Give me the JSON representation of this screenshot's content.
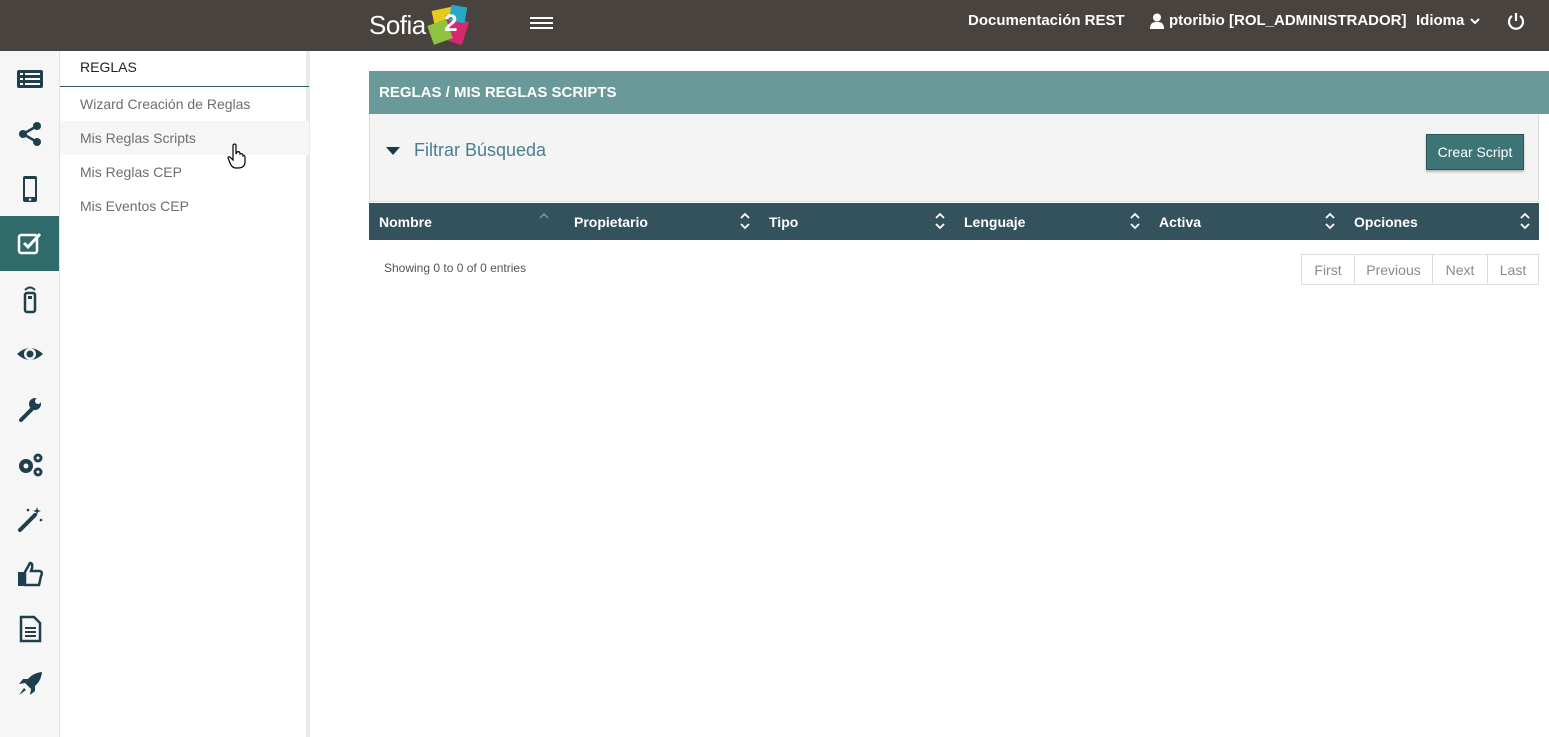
{
  "header": {
    "logo_text": "Sofia",
    "logo_mark": "2",
    "doc_link": "Documentación REST",
    "user": "ptoribio [ROL_ADMINISTRADOR]",
    "language": "Idioma"
  },
  "rail": {
    "icons": [
      "list-icon",
      "share-icon",
      "mobile-icon",
      "edit-check-icon",
      "remote-icon",
      "eye-icon",
      "wrench-icon",
      "gears-icon",
      "magic-wand-icon",
      "thumbs-up-icon",
      "document-icon",
      "rocket-icon"
    ],
    "active": "edit-check-icon"
  },
  "submenu": {
    "title": "REGLAS",
    "items": [
      {
        "label": "Wizard Creación de Reglas"
      },
      {
        "label": "Mis Reglas Scripts"
      },
      {
        "label": "Mis Reglas CEP"
      },
      {
        "label": "Mis Eventos CEP"
      }
    ]
  },
  "main": {
    "breadcrumb": "REGLAS / MIS REGLAS SCRIPTS",
    "filter_label": "Filtrar Búsqueda",
    "create_button": "Crear Script",
    "columns": [
      {
        "label": "Nombre"
      },
      {
        "label": "Propietario"
      },
      {
        "label": "Tipo"
      },
      {
        "label": "Lenguaje"
      },
      {
        "label": "Activa"
      },
      {
        "label": "Opciones"
      }
    ],
    "info": "Showing 0 to 0 of 0 entries",
    "pager": [
      {
        "label": "First"
      },
      {
        "label": "Previous"
      },
      {
        "label": "Next"
      },
      {
        "label": "Last"
      }
    ]
  },
  "colors": {
    "topbar": "#48433e",
    "accent": "#2f6b6a",
    "panel_header": "#6a9999",
    "table_header": "#33525d"
  }
}
